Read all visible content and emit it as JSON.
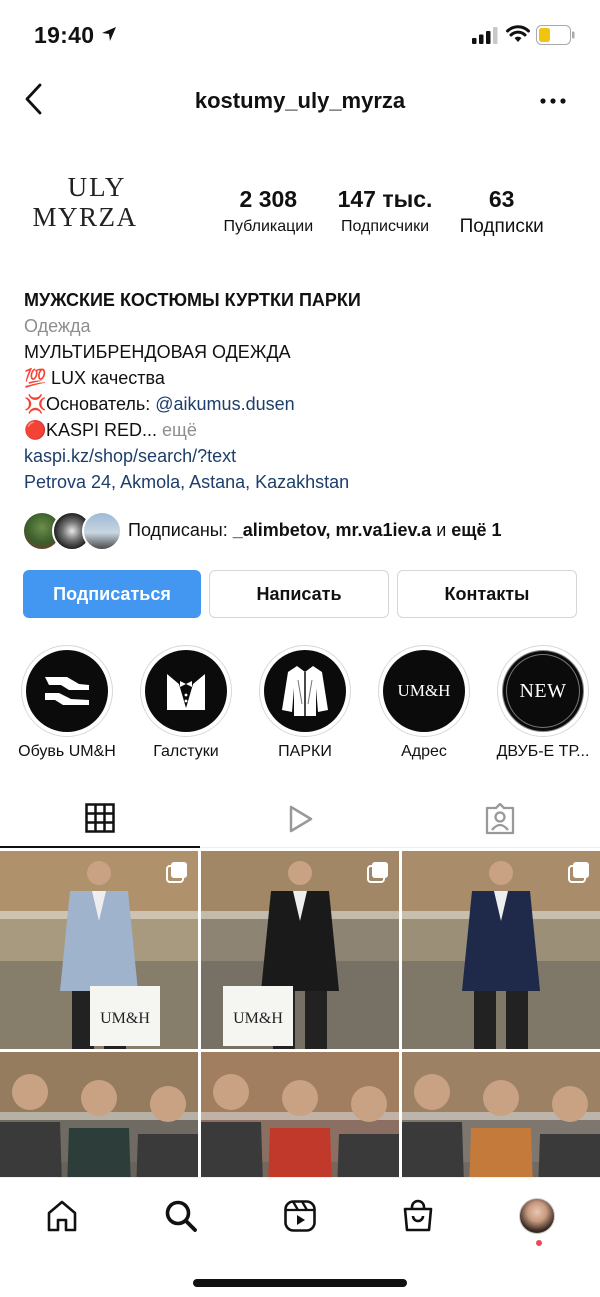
{
  "status_bar": {
    "time": "19:40"
  },
  "nav": {
    "username": "kostumy_uly_myrza"
  },
  "logo": {
    "line1": "ULY",
    "line2": "MYRZA"
  },
  "stats": [
    {
      "value": "2 308",
      "label": "Публикации"
    },
    {
      "value": "147 тыс.",
      "label": "Подписчики"
    },
    {
      "value": "63",
      "label": "Подписки"
    }
  ],
  "bio": {
    "name": "МУЖСКИЕ КОСТЮМЫ КУРТКИ ПАРКИ",
    "category": "Одежда",
    "line1": "МУЛЬТИБРЕНДОВАЯ ОДЕЖДА",
    "line2_emoji": "💯",
    "line2": " LUX качества",
    "line3_emoji": "💢",
    "line3_prefix": "Основатель: ",
    "line3_mention": "@aikumus.dusen",
    "line4_emoji": "🔴",
    "line4": "KASPI RED...",
    "more": " ещё",
    "link": "kaspi.kz/shop/search/?text",
    "address": "Petrova 24, Akmola, Astana, Kazakhstan"
  },
  "followed_by": {
    "prefix": "Подписаны: ",
    "user1": "_alimbetov",
    "sep": ", ",
    "user2": "mr.va1iev.a",
    "and": " и ",
    "more": "ещё 1"
  },
  "buttons": {
    "follow": "Подписаться",
    "message": "Написать",
    "contacts": "Контакты"
  },
  "highlights": [
    {
      "label": "Обувь UM&H",
      "icon": "shoe-icon"
    },
    {
      "label": "Галстуки",
      "icon": "tuxedo-icon"
    },
    {
      "label": "ПАРКИ",
      "icon": "jacket-icon"
    },
    {
      "label": "Адрес",
      "icon": "umh-logo",
      "text": "UM&H"
    },
    {
      "label": "ДВУБ-Е ТР...",
      "icon": "new-badge",
      "text": "NEW"
    }
  ],
  "grid_posts": [
    {
      "bg": "#a89a7e",
      "suit": "#9fb3cc",
      "bag": "UM&H"
    },
    {
      "bg": "#8d8474",
      "suit": "#1a1a1a",
      "bag": "UM&H"
    },
    {
      "bg": "#9c8f78",
      "suit": "#1f2a4a",
      "bag": ""
    },
    {
      "bg": "#6f6a62",
      "suit": "#2c3d3a",
      "bag": ""
    },
    {
      "bg": "#8a6f62",
      "suit": "#c0392b",
      "bag": ""
    },
    {
      "bg": "#7e7770",
      "suit": "#c47a3a",
      "bag": ""
    }
  ],
  "colors": {
    "accent": "#4397f0",
    "link": "#1d3e6b",
    "notification": "#ed4956"
  }
}
